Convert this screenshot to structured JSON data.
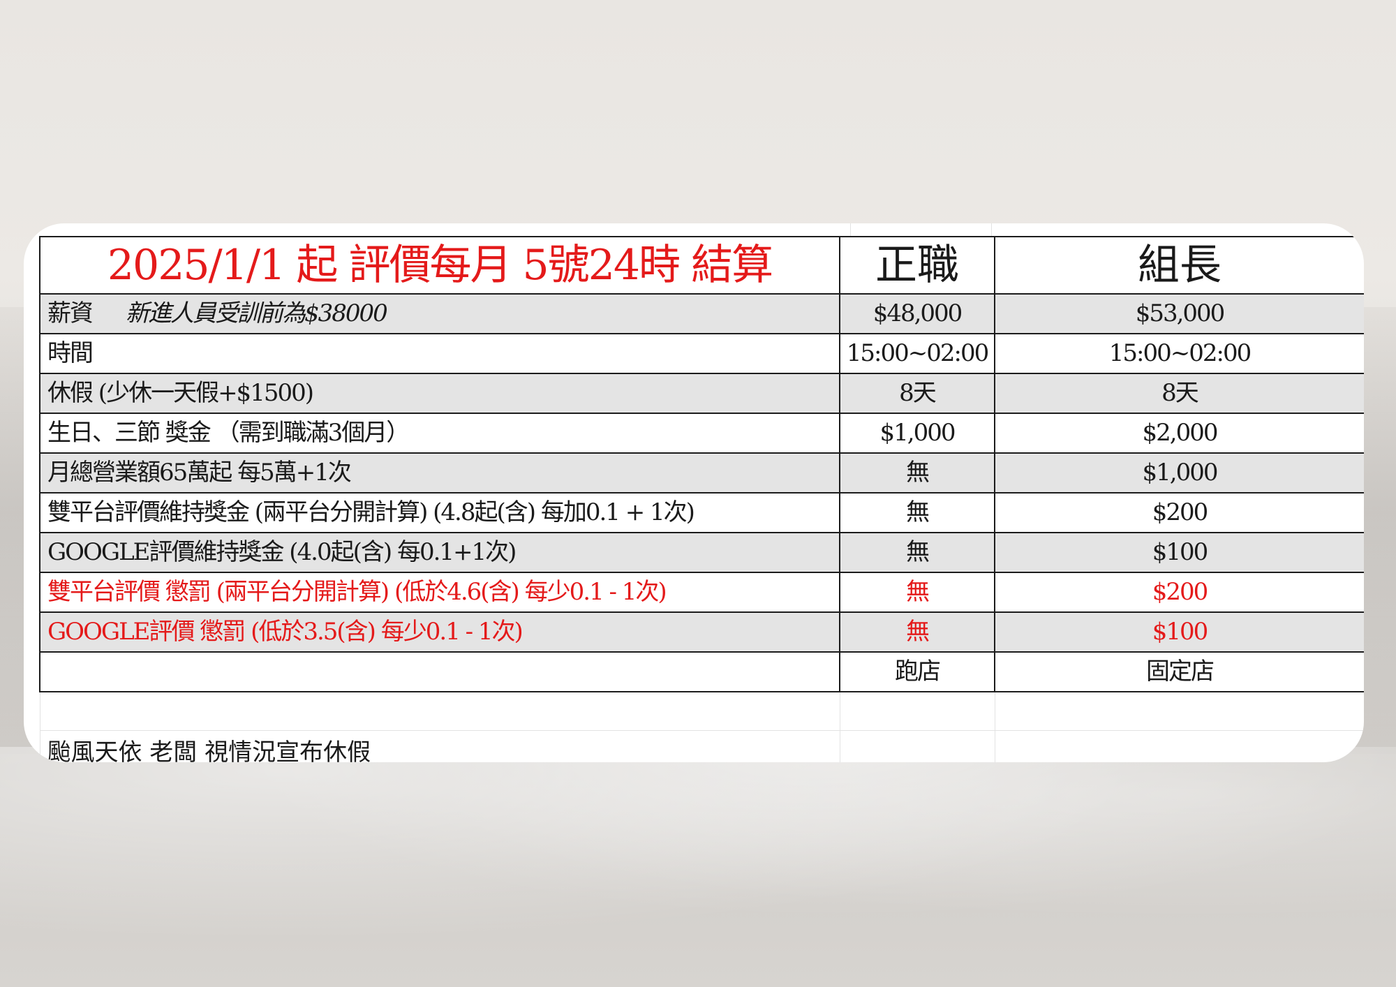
{
  "table": {
    "title": "2025/1/1 起  評價每月 5號24時 結算",
    "col_full_time": "正職",
    "col_leader": "組長",
    "rows": [
      {
        "label": "薪資",
        "note": "新進人員受訓前為$38000",
        "full_time": "$48,000",
        "leader": "$53,000"
      },
      {
        "label": "時間",
        "full_time": "15:00~02:00",
        "leader": "15:00~02:00"
      },
      {
        "label": "休假 (少休一天假+$1500)",
        "full_time": "8天",
        "leader": "8天"
      },
      {
        "label": "生日、三節 獎金 （需到職滿3個月）",
        "full_time": "$1,000",
        "leader": "$2,000"
      },
      {
        "label": "月總營業額65萬起 每5萬+1次",
        "full_time": "無",
        "leader": "$1,000"
      },
      {
        "label": "雙平台評價維持獎金 (兩平台分開計算) (4.8起(含) 每加0.1 + 1次)",
        "full_time": "無",
        "leader": "$200"
      },
      {
        "label": "GOOGLE評價維持獎金 (4.0起(含) 每0.1+1次)",
        "full_time": "無",
        "leader": "$100"
      },
      {
        "label": "雙平台評價 懲罰 (兩平台分開計算) (低於4.6(含) 每少0.1 - 1次)",
        "full_time": "無",
        "leader": "$200"
      },
      {
        "label": "GOOGLE評價 懲罰 (低於3.5(含)  每少0.1 - 1次)",
        "full_time": "無",
        "leader": "$100"
      },
      {
        "label": "",
        "full_time": "跑店",
        "leader": "固定店"
      }
    ],
    "footer_note": "颱風天依 老闆 視情況宣布休假"
  },
  "colors": {
    "title_red": "#e41a1a",
    "penalty_red": "#e41a1a",
    "row_shade": "#e4e4e4",
    "border": "#1c1c1c"
  }
}
